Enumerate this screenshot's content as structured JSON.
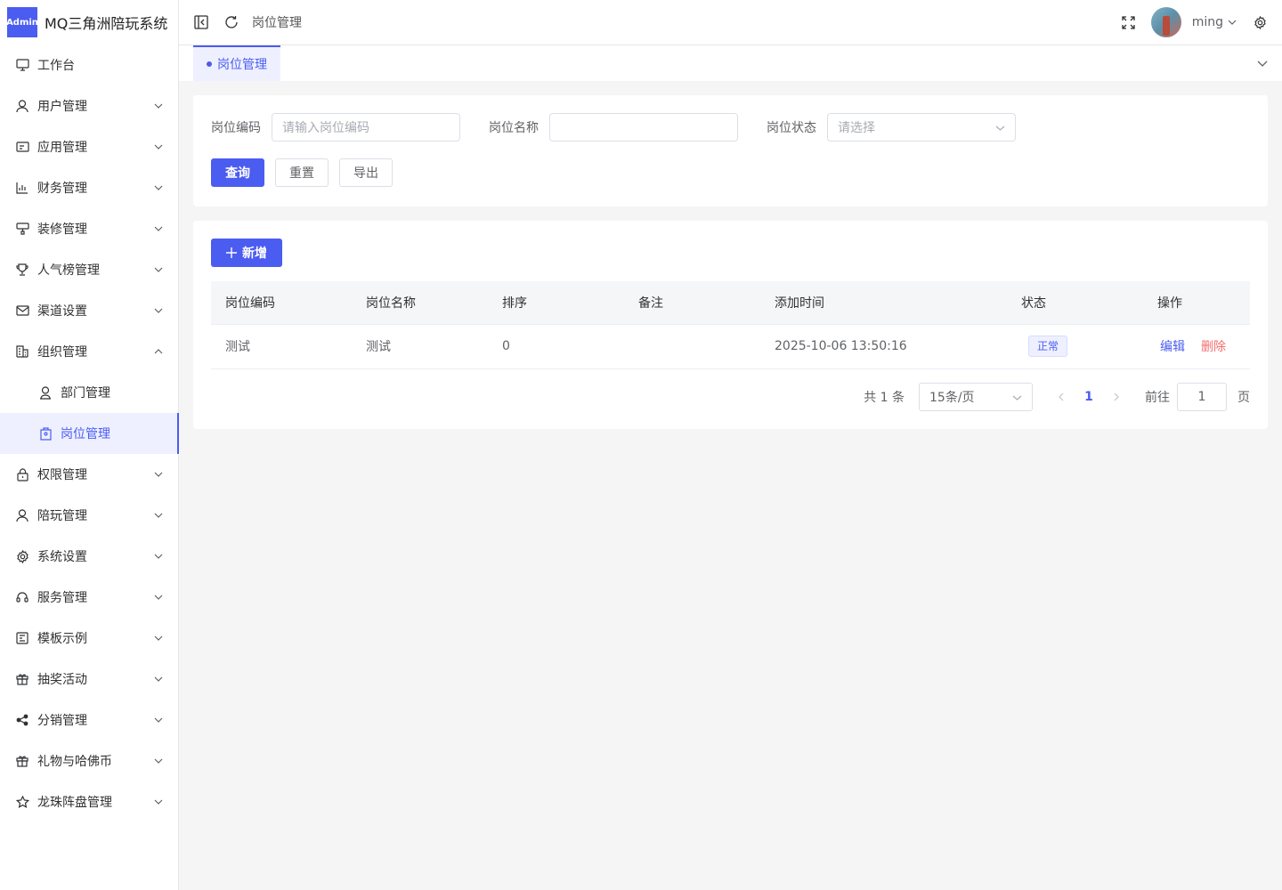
{
  "app": {
    "badge": "Admin",
    "title": "MQ三角洲陪玩系统"
  },
  "sidebar": {
    "items": [
      {
        "label": "工作台",
        "icon": "monitor-icon"
      },
      {
        "label": "用户管理",
        "icon": "user-icon"
      },
      {
        "label": "应用管理",
        "icon": "app-icon"
      },
      {
        "label": "财务管理",
        "icon": "chart-icon"
      },
      {
        "label": "装修管理",
        "icon": "brush-icon"
      },
      {
        "label": "人气榜管理",
        "icon": "trophy-icon"
      },
      {
        "label": "渠道设置",
        "icon": "mail-icon"
      },
      {
        "label": "组织管理",
        "icon": "office-icon"
      },
      {
        "label": "部门管理",
        "icon": "user-icon"
      },
      {
        "label": "岗位管理",
        "icon": "badge-icon"
      },
      {
        "label": "权限管理",
        "icon": "lock-icon"
      },
      {
        "label": "陪玩管理",
        "icon": "user-icon"
      },
      {
        "label": "系统设置",
        "icon": "gear-icon"
      },
      {
        "label": "服务管理",
        "icon": "headset-icon"
      },
      {
        "label": "模板示例",
        "icon": "template-icon"
      },
      {
        "label": "抽奖活动",
        "icon": "gift-icon"
      },
      {
        "label": "分销管理",
        "icon": "share-icon"
      },
      {
        "label": "礼物与哈佛币",
        "icon": "gift-icon"
      },
      {
        "label": "龙珠阵盘管理",
        "icon": "star-icon"
      }
    ]
  },
  "header": {
    "breadcrumb": "岗位管理",
    "username": "ming"
  },
  "tabs": [
    {
      "label": "岗位管理"
    }
  ],
  "search": {
    "code_label": "岗位编码",
    "code_placeholder": "请输入岗位编码",
    "name_label": "岗位名称",
    "name_value": "",
    "status_label": "岗位状态",
    "status_placeholder": "请选择",
    "query": "查询",
    "reset": "重置",
    "export": "导出"
  },
  "table": {
    "add_label": "新增",
    "columns": [
      "岗位编码",
      "岗位名称",
      "排序",
      "备注",
      "添加时间",
      "状态",
      "操作"
    ],
    "rows": [
      {
        "code": "测试",
        "name": "测试",
        "sort": "0",
        "remark": "",
        "time": "2025-10-06 13:50:16",
        "status": "正常",
        "edit": "编辑",
        "delete": "删除"
      }
    ]
  },
  "pagination": {
    "total": "共 1 条",
    "page_size": "15条/页",
    "current": "1",
    "goto_label": "前往",
    "goto_value": "1",
    "page_suffix": "页"
  },
  "colors": {
    "primary": "#4b5cf0",
    "danger": "#f56c6c"
  }
}
